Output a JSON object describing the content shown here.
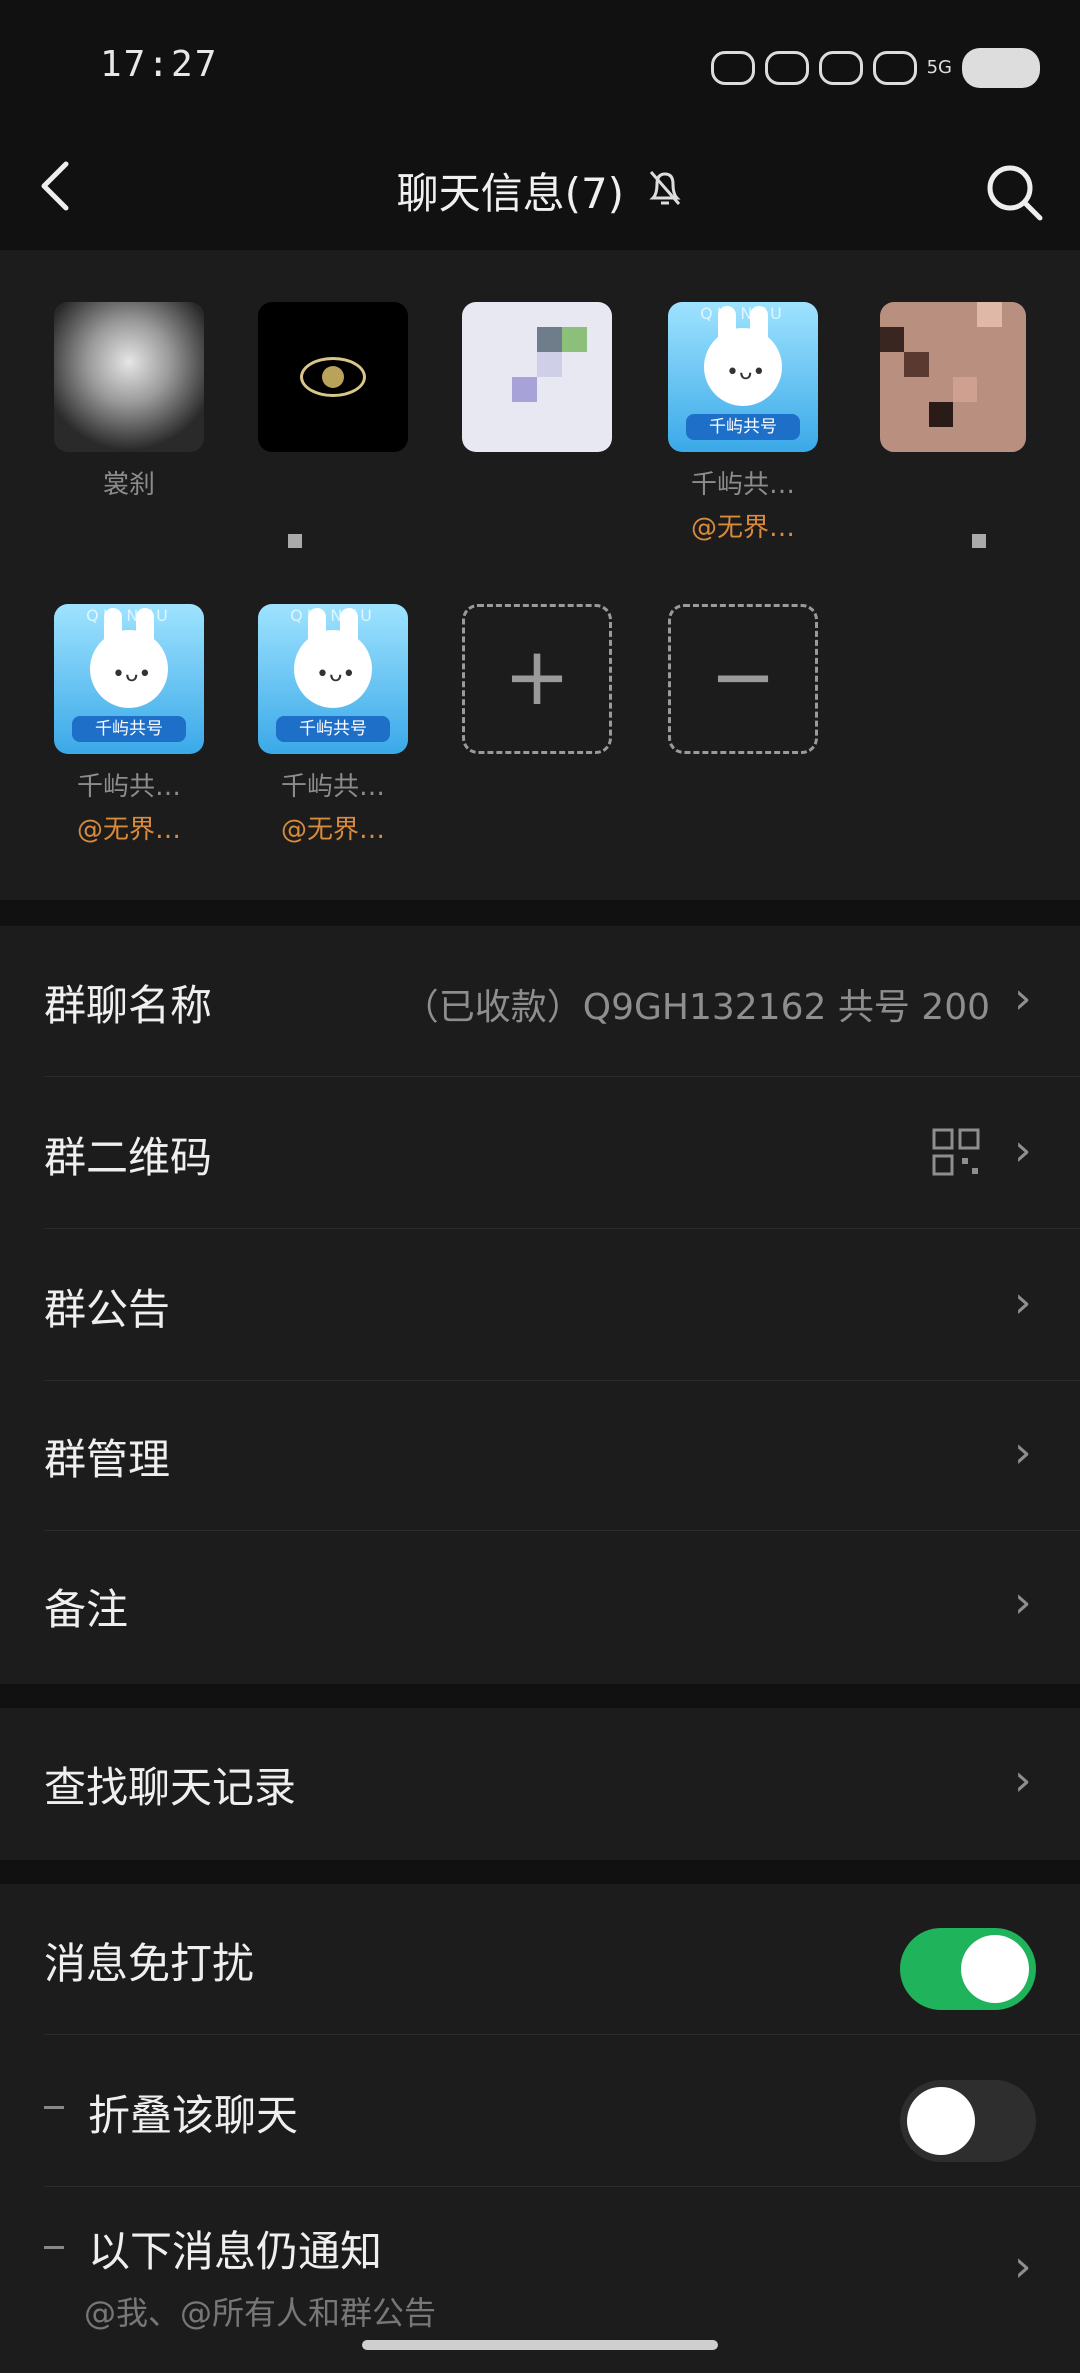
{
  "status": {
    "time": "17:27",
    "network": "5G"
  },
  "header": {
    "title": "聊天信息(7)"
  },
  "members": [
    {
      "name": "裳刹",
      "tag": ""
    },
    {
      "name": "",
      "tag": ""
    },
    {
      "name": "",
      "tag": ""
    },
    {
      "name": "千屿共…",
      "tag": "@无界…"
    },
    {
      "name": "",
      "tag": ""
    },
    {
      "name": "千屿共…",
      "tag": "@无界…"
    },
    {
      "name": "千屿共…",
      "tag": "@无界…"
    }
  ],
  "avatar_badge": "千屿共号",
  "avatar_brand": "QIANYU",
  "group": {
    "name_label": "群聊名称",
    "name_value": "（已收款）Q9GH132162 共号 200",
    "qr_label": "群二维码",
    "notice_label": "群公告",
    "manage_label": "群管理",
    "remark_label": "备注"
  },
  "search_history_label": "查找聊天记录",
  "settings": {
    "mute_label": "消息免打扰",
    "mute_on": true,
    "fold_label": "折叠该聊天",
    "fold_on": false,
    "notify_label": "以下消息仍通知",
    "notify_sub": "@我、@所有人和群公告"
  },
  "colors": {
    "accent_green": "#1fb35c",
    "tag_orange": "#d98a3a",
    "panel": "#1c1c1c",
    "background": "#111111"
  }
}
